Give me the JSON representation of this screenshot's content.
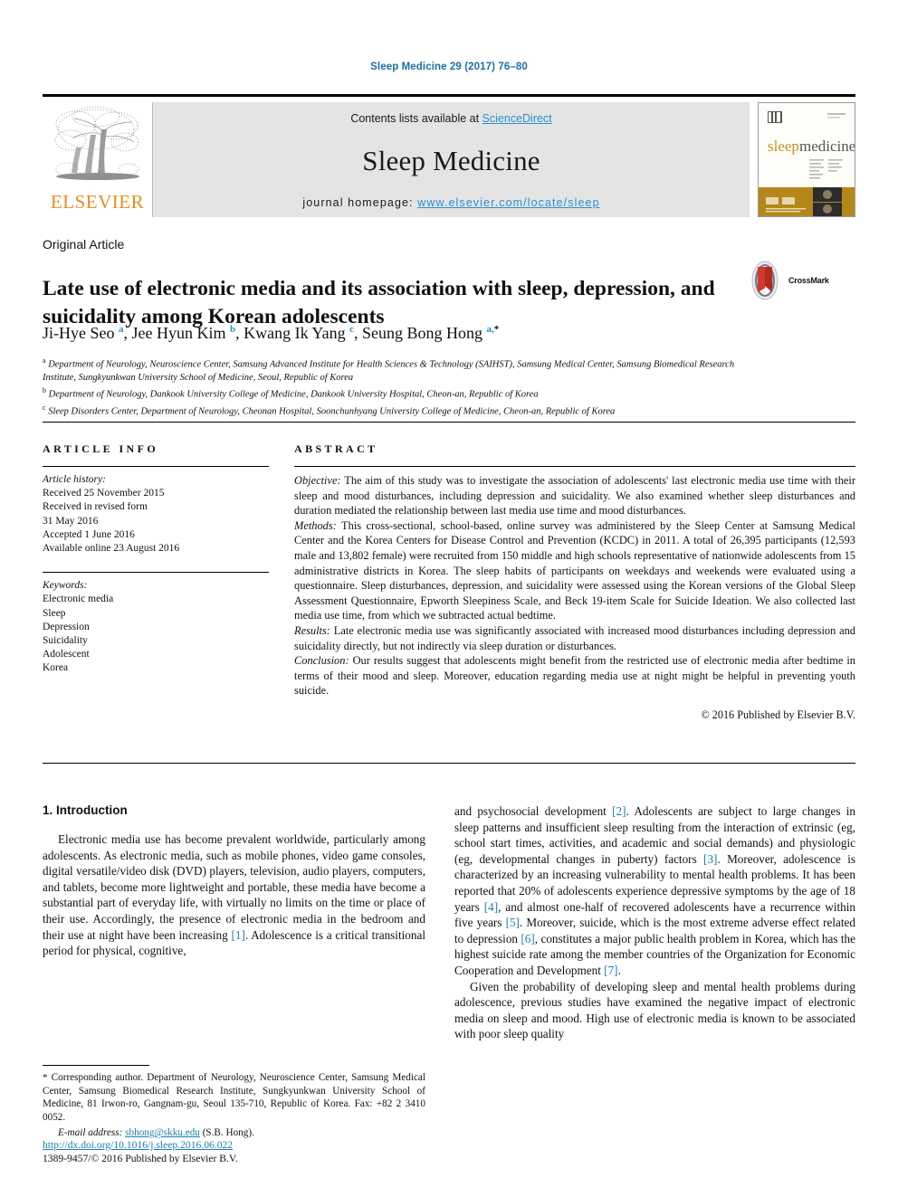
{
  "running_head": "Sleep Medicine 29 (2017) 76–80",
  "masthead": {
    "contents_prefix": "Contents lists available at ",
    "sciencedirect": "ScienceDirect",
    "journal_name": "Sleep Medicine",
    "homepage_prefix": "journal homepage: ",
    "homepage_url": "www.elsevier.com/locate/sleep",
    "publisher": "ELSEVIER",
    "cover_title_a": "sleep",
    "cover_title_b": "medicine",
    "link_color": "#2b8fd1",
    "band_color": "#e4e4e4",
    "elsevier_orange": "#ed8b1f"
  },
  "article": {
    "type": "Original Article",
    "title": "Late use of electronic media and its association with sleep, depression, and suicidality among Korean adolescents",
    "crossmark_label": "CrossMark",
    "authors_html": "Ji-Hye Seo <sup>a</sup>, Jee Hyun Kim <sup>b</sup>, Kwang Ik Yang <sup>c</sup>, Seung Bong Hong <sup>a,</sup><sup class=\"star\">*</sup>",
    "affiliations": [
      {
        "marker": "a",
        "text": "Department of Neurology, Neuroscience Center, Samsung Advanced Institute for Health Sciences & Technology (SAIHST), Samsung Medical Center, Samsung Biomedical Research Institute, Sungkyunkwan University School of Medicine, Seoul, Republic of Korea"
      },
      {
        "marker": "b",
        "text": "Department of Neurology, Dankook University College of Medicine, Dankook University Hospital, Cheon-an, Republic of Korea"
      },
      {
        "marker": "c",
        "text": "Sleep Disorders Center, Department of Neurology, Cheonan Hospital, Soonchunhyang University College of Medicine, Cheon-an, Republic of Korea"
      }
    ]
  },
  "article_info": {
    "heading": "ARTICLE INFO",
    "history_label": "Article history:",
    "history": [
      "Received 25 November 2015",
      "Received in revised form",
      "31 May 2016",
      "Accepted 1 June 2016",
      "Available online 23 August 2016"
    ],
    "keywords_label": "Keywords:",
    "keywords": [
      "Electronic media",
      "Sleep",
      "Depression",
      "Suicidality",
      "Adolescent",
      "Korea"
    ]
  },
  "abstract": {
    "heading": "ABSTRACT",
    "objective_label": "Objective:",
    "objective_text": " The aim of this study was to investigate the association of adolescents' last electronic media use time with their sleep and mood disturbances, including depression and suicidality. We also examined whether sleep disturbances and duration mediated the relationship between last media use time and mood disturbances.",
    "methods_label": "Methods:",
    "methods_text": " This cross-sectional, school-based, online survey was administered by the Sleep Center at Samsung Medical Center and the Korea Centers for Disease Control and Prevention (KCDC) in 2011. A total of 26,395 participants (12,593 male and 13,802 female) were recruited from 150 middle and high schools representative of nationwide adolescents from 15 administrative districts in Korea. The sleep habits of participants on weekdays and weekends were evaluated using a questionnaire. Sleep disturbances, depression, and suicidality were assessed using the Korean versions of the Global Sleep Assessment Questionnaire, Epworth Sleepiness Scale, and Beck 19-item Scale for Suicide Ideation. We also collected last media use time, from which we subtracted actual bedtime.",
    "results_label": "Results:",
    "results_text": " Late electronic media use was significantly associated with increased mood disturbances including depression and suicidality directly, but not indirectly via sleep duration or disturbances.",
    "conclusion_label": "Conclusion:",
    "conclusion_text": " Our results suggest that adolescents might benefit from the restricted use of electronic media after bedtime in terms of their mood and sleep. Moreover, education regarding media use at night might be helpful in preventing youth suicide.",
    "copyright": "© 2016 Published by Elsevier B.V."
  },
  "intro": {
    "heading": "1. Introduction",
    "left_paragraph_1_a": "Electronic media use has become prevalent worldwide, particularly among adolescents. As electronic media, such as mobile phones, video game consoles, digital versatile/video disk (DVD) players, television, audio players, computers, and tablets, become more lightweight and portable, these media have become a substantial part of everyday life, with virtually no limits on the time or place of their use. Accordingly, the presence of electronic media in the bedroom and their use at night have been increasing ",
    "left_ref_1": "[1]",
    "left_paragraph_1_b": ". Adolescence is a critical transitional period for physical, cognitive,",
    "right_paragraph_1_a": "and psychosocial development ",
    "right_ref_2": "[2]",
    "right_paragraph_1_b": ". Adolescents are subject to large changes in sleep patterns and insufficient sleep resulting from the interaction of extrinsic (eg, school start times, activities, and academic and social demands) and physiologic (eg, developmental changes in puberty) factors ",
    "right_ref_3": "[3]",
    "right_paragraph_1_c": ". Moreover, adolescence is characterized by an increasing vulnerability to mental health problems. It has been reported that 20% of adolescents experience depressive symptoms by the age of 18 years ",
    "right_ref_4": "[4]",
    "right_paragraph_1_d": ", and almost one-half of recovered adolescents have a recurrence within five years ",
    "right_ref_5": "[5]",
    "right_paragraph_1_e": ". Moreover, suicide, which is the most extreme adverse effect related to depression ",
    "right_ref_6": "[6]",
    "right_paragraph_1_f": ", constitutes a major public health problem in Korea, which has the highest suicide rate among the member countries of the Organization for Economic Cooperation and Development ",
    "right_ref_7": "[7]",
    "right_paragraph_1_g": ".",
    "right_paragraph_2": "Given the probability of developing sleep and mental health problems during adolescence, previous studies have examined the negative impact of electronic media on sleep and mood. High use of electronic media is known to be associated with poor sleep quality"
  },
  "footnote": {
    "star": "*",
    "corresponding_text": " Corresponding author. Department of Neurology, Neuroscience Center, Samsung Medical Center, Samsung Biomedical Research Institute, Sungkyunkwan University School of Medicine, 81 Irwon-ro, Gangnam-gu, Seoul 135-710, Republic of Korea. Fax: +82 2 3410 0052.",
    "email_label": "E-mail address:",
    "email": "sbhong@skku.edu",
    "email_suffix": " (S.B. Hong)."
  },
  "footer": {
    "doi": "http://dx.doi.org/10.1016/j.sleep.2016.06.022",
    "issn_line": "1389-9457/© 2016 Published by Elsevier B.V."
  }
}
